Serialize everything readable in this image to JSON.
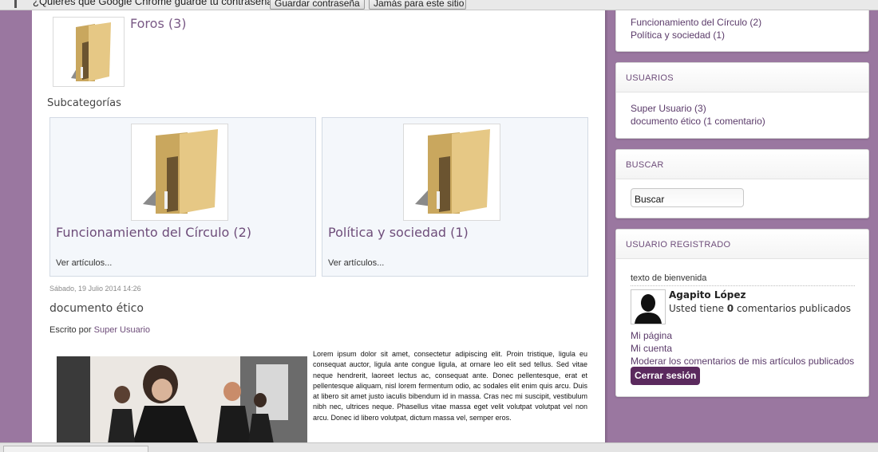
{
  "password_bar": {
    "question": "¿Quieres que Google Chrome guarde tu contraseña?",
    "save_label": "Guardar contraseña",
    "never_label": "Jamás para este sitio"
  },
  "forums": {
    "title": "Foros (3)"
  },
  "subcategories": {
    "heading": "Subcategorías",
    "items": [
      {
        "name": "Funcionamiento del Círculo (2)",
        "more": "Ver artículos..."
      },
      {
        "name": "Política y sociedad (1)",
        "more": "Ver artículos..."
      }
    ]
  },
  "article": {
    "date": "Sábado, 19 Julio 2014 14:26",
    "title": "documento ético",
    "byline_prefix": "Escrito por",
    "author": "Super Usuario",
    "body": "Lorem ipsum dolor sit amet, consectetur adipiscing elit. Proin tristique, ligula eu consequat auctor, ligula ante congue ligula, at ornare leo elit sed tellus. Sed vitae neque hendrerit, laoreet lectus ac, consequat ante. Donec pellentesque, erat et pellentesque aliquam, nisl lorem fermentum odio, ac sodales elit enim quis arcu. Duis at libero sit amet justo iaculis bibendum id in massa. Cras nec mi suscipit, vestibulum nibh nec, ultrices neque. Phasellus vitae massa eget velit volutpat volutpat vel non arcu. Donec id libero volutpat, dictum massa vel, semper eros."
  },
  "sidebar": {
    "categories": {
      "items": [
        "Funcionamiento del Círculo  (2)",
        "Política y sociedad  (1)"
      ]
    },
    "users": {
      "title": "USUARIOS",
      "items": [
        "Super Usuario (3)",
        "documento ético (1 comentario)"
      ]
    },
    "search": {
      "title": "BUSCAR",
      "value": "Buscar"
    },
    "registered": {
      "title": "USUARIO REGISTRADO",
      "welcome": "texto de bienvenida",
      "name": "Agapito López",
      "count_prefix": "Usted tiene ",
      "count": "0",
      "count_suffix": " comentarios publicados",
      "links": [
        "Mi página",
        "Mi cuenta",
        "Moderar los comentarios de mis artículos publicados"
      ],
      "logout": "Cerrar sesión"
    }
  },
  "colors": {
    "background": "#9a77a0",
    "accent": "#6e4d7a",
    "logout_button": "#5b2a5e"
  },
  "icons": [
    "key-icon",
    "folder-icon",
    "avatar-silhouette-icon"
  ]
}
